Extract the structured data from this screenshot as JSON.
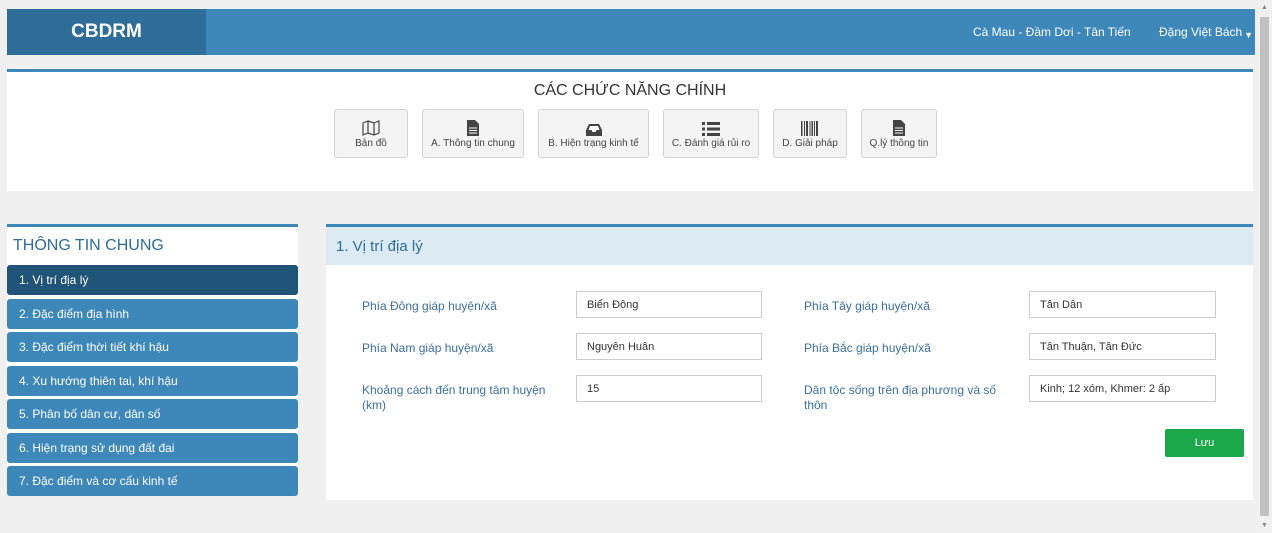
{
  "header": {
    "brand": "CBDRM",
    "location": "Cà Mau - Đầm Dơi - Tân Tiến",
    "user": "Đặng Việt Bách"
  },
  "functions": {
    "title": "CÁC CHỨC NĂNG CHÍNH",
    "buttons": [
      {
        "label": "Bản đồ",
        "icon": "map-icon"
      },
      {
        "label": "A. Thông tin chung",
        "icon": "file-icon"
      },
      {
        "label": "B. Hiện trạng kinh tế",
        "icon": "inbox-icon"
      },
      {
        "label": "C. Đánh giá rủi ro",
        "icon": "list-icon"
      },
      {
        "label": "D. Giải pháp",
        "icon": "barcode-icon"
      },
      {
        "label": "Q.lý thông tin",
        "icon": "file-icon"
      }
    ]
  },
  "sidebar": {
    "title": "THÔNG TIN CHUNG",
    "items": [
      {
        "label": "1. Vị trí địa lý"
      },
      {
        "label": "2. Đặc điểm địa hình"
      },
      {
        "label": "3. Đặc điểm thời tiết khí hậu"
      },
      {
        "label": "4. Xu hướng thiên tai, khí hậu"
      },
      {
        "label": "5. Phân bố dân cư, dân số"
      },
      {
        "label": "6. Hiện trạng sử dụng đất đai"
      },
      {
        "label": "7. Đặc điểm và cơ cấu kinh tế"
      }
    ]
  },
  "content": {
    "title": "1. Vị trí địa lý",
    "fields": {
      "east": {
        "label": "Phía Đông giáp huyện/xã",
        "value": "Biển Đông"
      },
      "west": {
        "label": "Phía Tây giáp huyện/xã",
        "value": "Tân Dân"
      },
      "south": {
        "label": "Phía Nam giáp huyện/xã",
        "value": "Nguyễn Huân"
      },
      "north": {
        "label": "Phía Bắc giáp huyện/xã",
        "value": "Tân Thuận, Tân Đức"
      },
      "distance": {
        "label": "Khoảng cách đến trung tâm huyện (km)",
        "value": "15"
      },
      "ethnic": {
        "label": "Dân tộc sống trên địa phương và số thôn",
        "value": "Kinh; 12 xóm, Khmer: 2 ấp"
      }
    },
    "save_label": "Lưu"
  },
  "colors": {
    "header": "#3d87b9",
    "brand_bg": "#2d6d98",
    "active_item": "#1f5378",
    "save_button": "#1aa84b"
  }
}
